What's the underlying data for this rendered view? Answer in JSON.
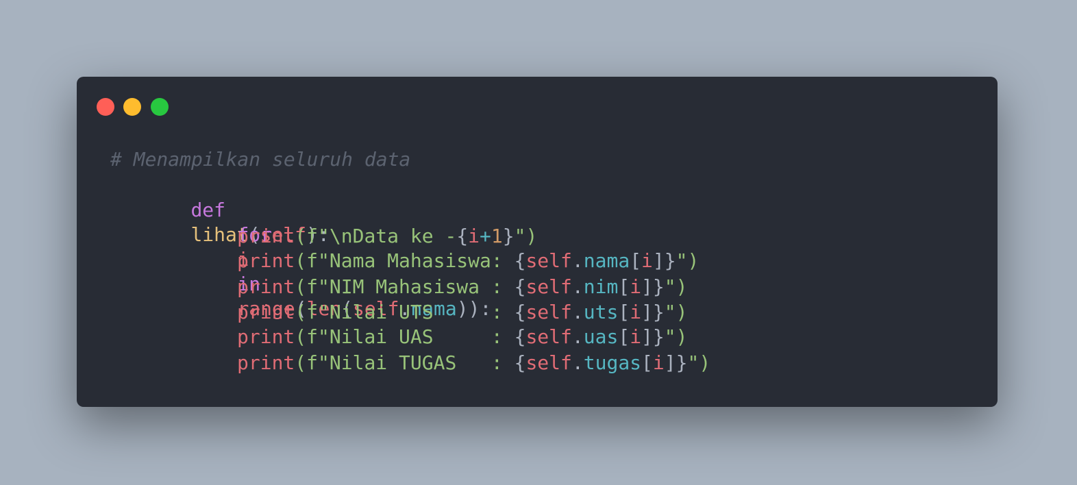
{
  "window": {
    "traffic_lights": [
      "close",
      "minimize",
      "maximize"
    ],
    "colors": {
      "background": "#282c35",
      "close": "#ff5f57",
      "minimize": "#febc2e",
      "maximize": "#28c840"
    }
  },
  "code": {
    "language": "python",
    "comment": "# Menampilkan seluruh data",
    "line1": {
      "kw": "def",
      "fn": "lihat",
      "open": "(",
      "self": "self",
      "close": "):"
    },
    "line2": {
      "kw_for": "for",
      "var": "i",
      "kw_in": "in",
      "range": "range",
      "p1": "(",
      "len": "len",
      "p2": "(",
      "self": "self",
      "dot": ".",
      "attr": "nama",
      "close": ")):"
    },
    "prints": [
      {
        "fn": "print",
        "open": "(f\"",
        "text": "\\nData ke -",
        "lb": "{",
        "var": "i",
        "op": "+",
        "num": "1",
        "rb": "}",
        "close": "\")"
      },
      {
        "fn": "print",
        "open": "(f\"",
        "text": "Nama Mahasiswa: ",
        "lb": "{",
        "self": "self",
        "dot": ".",
        "attr": "nama",
        "idx_open": "[",
        "idx": "i",
        "idx_close": "]",
        "rb": "}",
        "close": "\")"
      },
      {
        "fn": "print",
        "open": "(f\"",
        "text": "NIM Mahasiswa : ",
        "lb": "{",
        "self": "self",
        "dot": ".",
        "attr": "nim",
        "idx_open": "[",
        "idx": "i",
        "idx_close": "]",
        "rb": "}",
        "close": "\")"
      },
      {
        "fn": "print",
        "open": "(f\"",
        "text": "Nilai UTS     : ",
        "lb": "{",
        "self": "self",
        "dot": ".",
        "attr": "uts",
        "idx_open": "[",
        "idx": "i",
        "idx_close": "]",
        "rb": "}",
        "close": "\")"
      },
      {
        "fn": "print",
        "open": "(f\"",
        "text": "Nilai UAS     : ",
        "lb": "{",
        "self": "self",
        "dot": ".",
        "attr": "uas",
        "idx_open": "[",
        "idx": "i",
        "idx_close": "]",
        "rb": "}",
        "close": "\")"
      },
      {
        "fn": "print",
        "open": "(f\"",
        "text": "Nilai TUGAS   : ",
        "lb": "{",
        "self": "self",
        "dot": ".",
        "attr": "tugas",
        "idx_open": "[",
        "idx": "i",
        "idx_close": "]",
        "rb": "}",
        "close": "\")"
      }
    ]
  }
}
